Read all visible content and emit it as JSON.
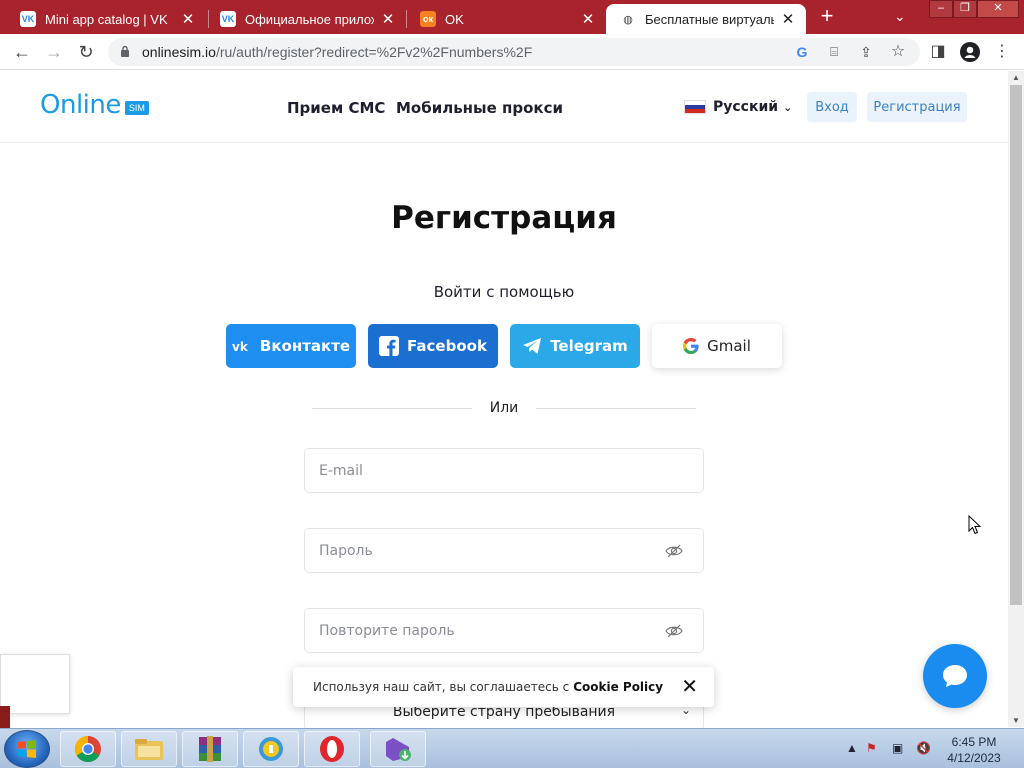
{
  "browser": {
    "tabs": [
      {
        "title": "Mini app catalog | VK",
        "favicon": "vk-icon",
        "active": false
      },
      {
        "title": "Официальное приложен",
        "favicon": "vk-icon",
        "active": false
      },
      {
        "title": "OK",
        "favicon": "ok-icon",
        "active": false
      },
      {
        "title": "Бесплатные виртуальны",
        "favicon": "globe-icon",
        "active": true
      }
    ],
    "url_host": "onlinesim.io",
    "url_path": "/ru/auth/register?redirect=%2Fv2%2Fnumbers%2F",
    "tab_color": "#a8232b"
  },
  "header": {
    "logo_text": "Online",
    "logo_badge": "SIM",
    "nav": [
      "Прием СМС",
      "Мобильные прокси"
    ],
    "language": "Русский",
    "login_label": "Вход",
    "register_label": "Регистрация",
    "accent_color": "#1a9be3"
  },
  "main": {
    "title": "Регистрация",
    "login_with": "Войти с помощью",
    "social": [
      {
        "label": "Вконтакте",
        "icon": "vk-icon",
        "color": "#1f8ef1"
      },
      {
        "label": "Facebook",
        "icon": "facebook-icon",
        "color": "#1a6fd0"
      },
      {
        "label": "Telegram",
        "icon": "telegram-icon",
        "color": "#2aa8e8"
      },
      {
        "label": "Gmail",
        "icon": "google-icon",
        "color": "#ffffff"
      }
    ],
    "or_text": "Или",
    "email_placeholder": "E-mail",
    "password_placeholder": "Пароль",
    "password_repeat_placeholder": "Повторите пароль",
    "country_select": "Выберите страну пребывания"
  },
  "cookie": {
    "text": "Используя наш сайт, вы соглашаетесь с",
    "link": "Cookie Policy"
  },
  "taskbar": {
    "apps": [
      "chrome-icon",
      "file-explorer-icon",
      "winrar-icon",
      "security-icon",
      "opera-icon",
      "visual-studio-icon"
    ],
    "time": "6:45 PM",
    "date": "4/12/2023"
  }
}
